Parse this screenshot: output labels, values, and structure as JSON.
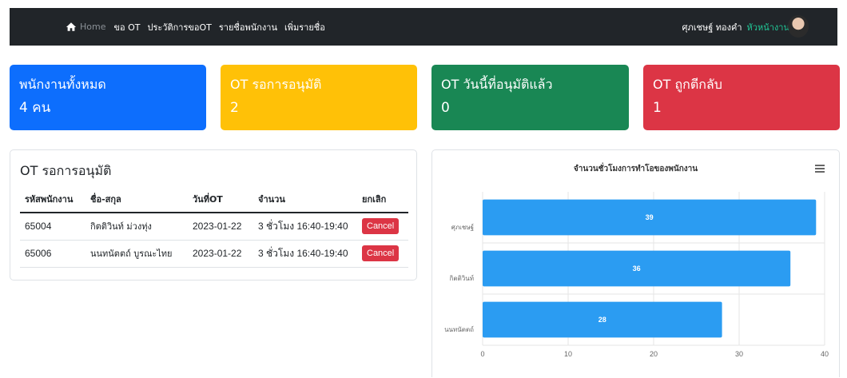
{
  "nav": {
    "home": "Home",
    "links": [
      "ขอ OT",
      "ประวัติการขอOT",
      "รายชื่อพนักงาน",
      "เพิ่มรายชื่อ"
    ],
    "user_name": "ศุภเชษฐ์ ทองคำ",
    "role": "หัวหน้างาน"
  },
  "stats": [
    {
      "title": "พนักงานทั้งหมด",
      "value": "4 คน",
      "color": "#0d6efd"
    },
    {
      "title": "OT รอการอนุมัติ",
      "value": "2",
      "color": "#ffc107"
    },
    {
      "title": "OT วันนี้ที่อนุมัติแล้ว",
      "value": "0",
      "color": "#198754"
    },
    {
      "title": "OT ถูกตีกลับ",
      "value": "1",
      "color": "#dc3545"
    }
  ],
  "pending": {
    "title": "OT รอการอนุมัติ",
    "headers": [
      "รหัสพนักงาน",
      "ชื่อ-สกุล",
      "วันที่OT",
      "จำนวน",
      "ยกเลิก"
    ],
    "rows": [
      {
        "id": "65004",
        "name": "กิตติวินท์ ม่วงทุ่ง",
        "date": "2023-01-22",
        "amount": "3 ชั่วโมง 16:40-19:40",
        "action": "Cancel"
      },
      {
        "id": "65006",
        "name": "นนทนัตตถ์ บูรณะไทย",
        "date": "2023-01-22",
        "amount": "3 ชั่วโมง 16:40-19:40",
        "action": "Cancel"
      }
    ]
  },
  "chart_data": {
    "type": "bar",
    "orientation": "horizontal",
    "title": "จำนวนชั่วโมงการทำโอของพนักงาน",
    "categories": [
      "ศุภเชษฐ์",
      "กิตติวินท์",
      "นนทนัตตถ์"
    ],
    "values": [
      39,
      36,
      28
    ],
    "xlim": [
      0,
      40
    ],
    "ticks": [
      0,
      10,
      20,
      30,
      40
    ],
    "grid": true,
    "bar_color": "#2b9cf2"
  }
}
